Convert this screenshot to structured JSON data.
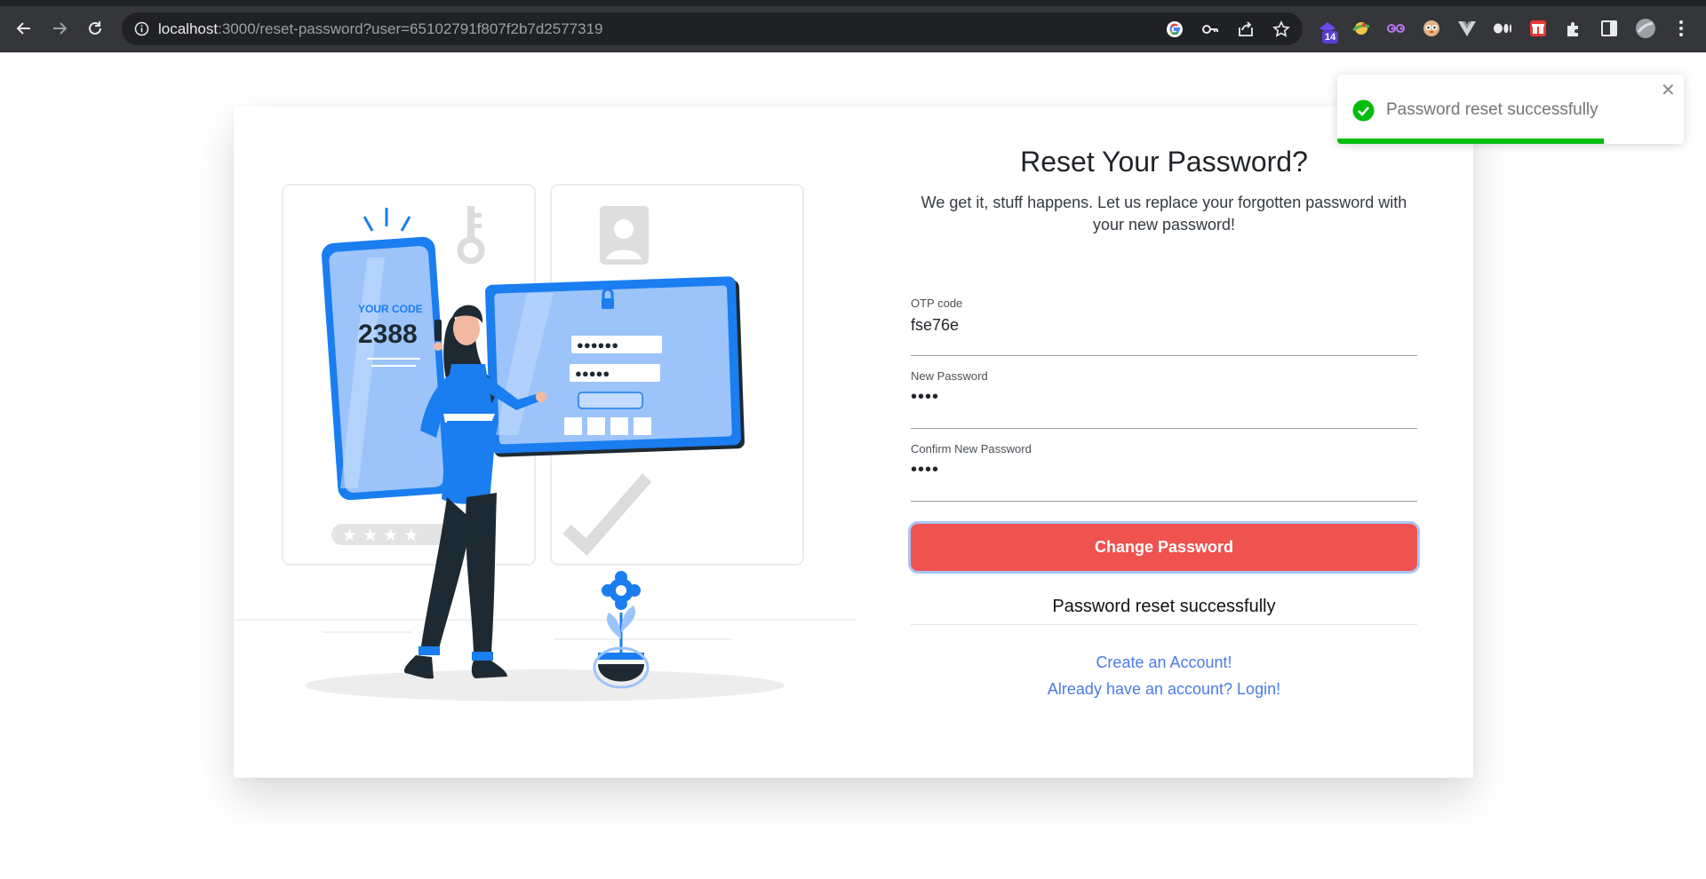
{
  "browser": {
    "url_host": "localhost",
    "url_rest": ":3000/reset-password?user=65102791f807f2b7d2577319",
    "extension_badge": "14"
  },
  "illustration": {
    "phone_caption": "YOUR CODE",
    "phone_code": "2388",
    "password_dots_1": "●●●●●●",
    "password_dots_2": "●●●●●"
  },
  "form": {
    "title": "Reset Your Password?",
    "subtitle": "We get it, stuff happens. Let us replace your forgotten password with your new password!",
    "otp": {
      "label": "OTP code",
      "value": "fse76e"
    },
    "new_password": {
      "label": "New Password",
      "value": "••••"
    },
    "confirm_password": {
      "label": "Confirm New Password",
      "value": "••••"
    },
    "submit_label": "Change Password",
    "status_message": "Password reset successfully",
    "create_account_link": "Create an Account!",
    "login_link": "Already have an account? Login!"
  },
  "toast": {
    "message": "Password reset successfully",
    "close_symbol": "✕",
    "progress_fraction": 0.77,
    "accent_color": "#07bc0c"
  },
  "colors": {
    "button": "#ef5350",
    "link": "#4a7be8",
    "illustration_blue": "#1a7df0"
  }
}
